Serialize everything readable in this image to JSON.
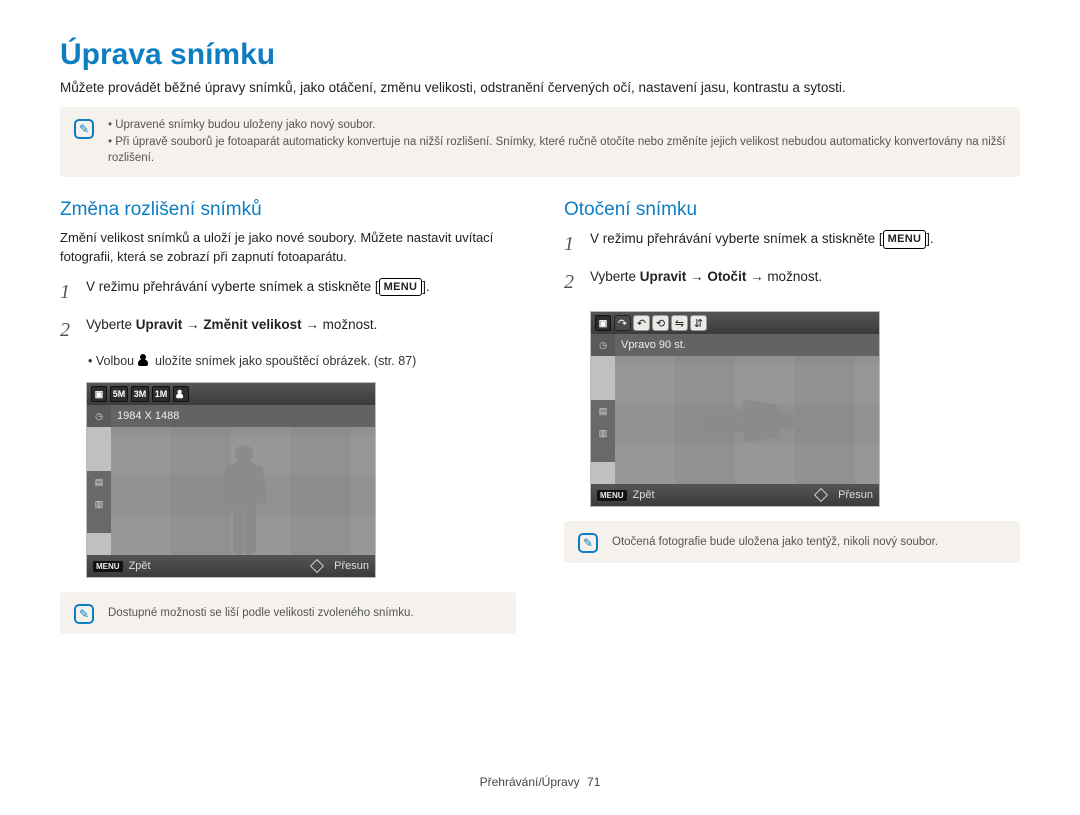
{
  "page": {
    "title": "Úprava snímku",
    "intro": "Můžete provádět běžné úpravy snímků, jako otáčení, změnu velikosti, odstranění červených očí, nastavení jasu, kontrastu a sytosti.",
    "footer_section": "Přehrávání/Úpravy",
    "footer_page": "71"
  },
  "top_note": {
    "items": [
      "Upravené snímky budou uloženy jako nový soubor.",
      "Při úpravě souborů je fotoaparát automaticky konvertuje na nižší rozlišení. Snímky, které ručně otočíte nebo změníte jejich velikost nebudou automaticky konvertovány na nižší rozlišení."
    ]
  },
  "left": {
    "heading": "Změna rozlišení snímků",
    "desc": "Změní velikost snímků a uloží je jako nové soubory. Můžete nastavit uvítací fotografii, která se zobrazí při zapnutí fotoaparátu.",
    "step1_pre": "V režimu přehrávání vyberte snímek a stiskněte [",
    "menu_label": "MENU",
    "step1_post": "].",
    "step2_pre": "Vyberte ",
    "step2_b1": "Upravit",
    "step2_arrow": " → ",
    "step2_b2": "Změnit velikost",
    "step2_post": " → možnost.",
    "sub_pre": "Volbou ",
    "sub_post": " uložíte snímek jako spouštěcí obrázek. (str. 87)",
    "lcd": {
      "size_options": [
        "5M",
        "3M",
        "1M"
      ],
      "current": "1984 X 1488",
      "back": "Zpět",
      "move": "Přesun",
      "menu": "MENU"
    },
    "bottom_note": "Dostupné možnosti se liší podle velikosti zvoleného snímku."
  },
  "right": {
    "heading": "Otočení snímku",
    "step1_pre": "V režimu přehrávání vyberte snímek a stiskněte [",
    "menu_label": "MENU",
    "step1_post": "].",
    "step2_pre": "Vyberte ",
    "step2_b1": "Upravit",
    "step2_arrow": " → ",
    "step2_b2": "Otočit",
    "step2_post": " → možnost.",
    "lcd": {
      "current": "Vpravo 90 st.",
      "back": "Zpět",
      "move": "Přesun",
      "menu": "MENU"
    },
    "bottom_note": "Otočená fotografie bude uložena jako tentýž, nikoli nový soubor."
  }
}
